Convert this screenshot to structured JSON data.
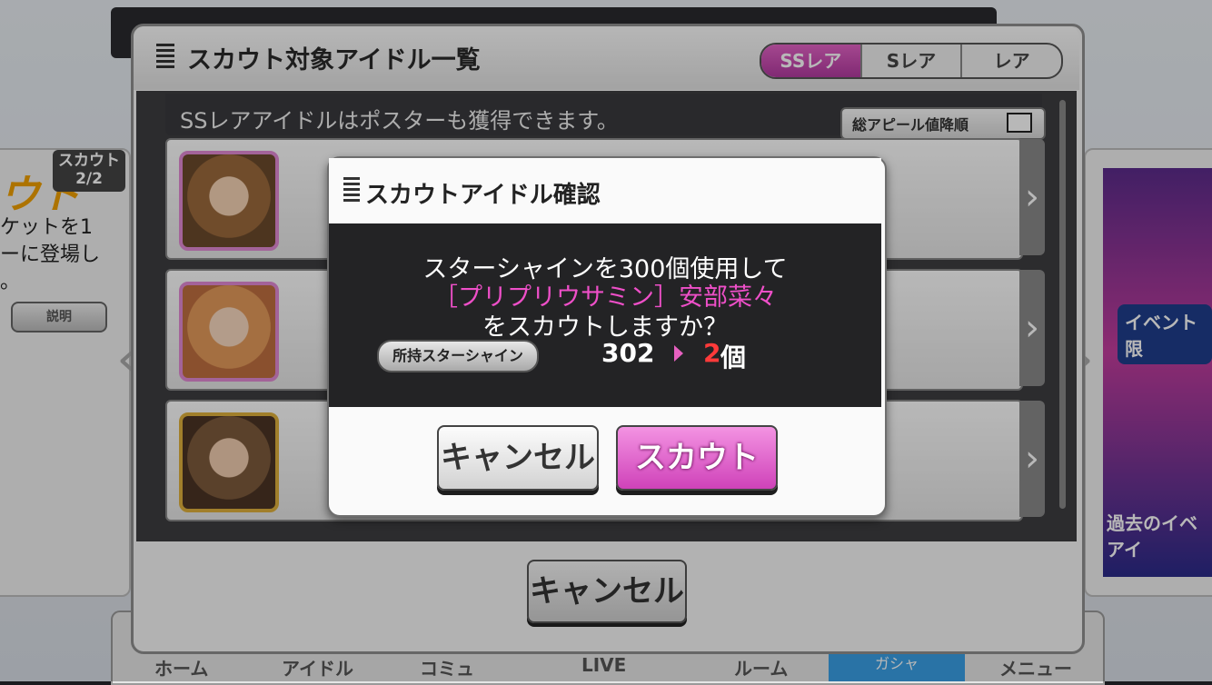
{
  "background": {
    "left_card": {
      "title": "ウト",
      "count": "スカウト\n2/2",
      "desc": "ケットを1\nーに登場し\n。",
      "button": "説明"
    },
    "right_card": {
      "banner_top": "イベント限",
      "banner_bottom": "過去のイベ\nアイ"
    }
  },
  "bottom_nav": [
    "ホーム",
    "アイドル",
    "コミュ",
    "LIVE",
    "ルーム",
    "ガシャ",
    "メニュー"
  ],
  "panel": {
    "title": "スカウト対象アイドル一覧",
    "rarity_tabs": [
      "SSレア",
      "Sレア",
      "レア"
    ],
    "active_tab": "SSレア",
    "info": "SSレアアイドルはポスターも獲得できます。",
    "sort_label": "総アピール値降順",
    "cancel_label": "キャンセル"
  },
  "dialog": {
    "title": "スカウトアイドル確認",
    "line1": "スターシャインを300個使用して",
    "idol_name": "［プリプリウサミン］安部菜々",
    "line3": "をスカウトしますか？",
    "owned_label": "所持スターシャイン",
    "owned_before": "302",
    "owned_after": "2",
    "owned_unit": "個",
    "cancel": "キャンセル",
    "scout": "スカウト"
  },
  "colors": {
    "accent_pink": "#e463c6",
    "warn_red": "#ff3a3a"
  },
  "icons": [
    "grip-icon",
    "sort-icon",
    "chevron-right-icon",
    "chevron-left-icon",
    "arrow-right-icon"
  ]
}
